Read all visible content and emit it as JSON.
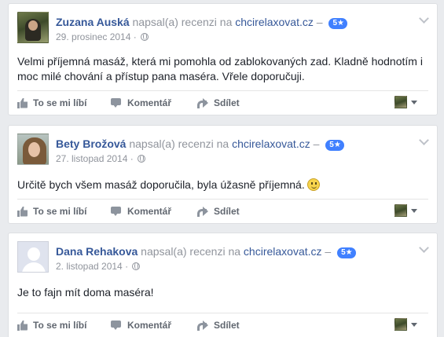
{
  "reviews": [
    {
      "author": "Zuzana Auská",
      "action_text": "napsal(a) recenzi na",
      "site": "chcirelaxovat.cz",
      "dash": "–",
      "rating_badge": "5★",
      "date": "29. prosinec 2014 ·",
      "text": "Velmi příjemná masáž, která mi pomohla od zablokovaných zad. Kladně hodnotím i moc milé chování a přístup pana maséra. Vřele doporučuji.",
      "avatar": "profile-photo"
    },
    {
      "author": "Bety Brožová",
      "action_text": "napsal(a) recenzi na",
      "site": "chcirelaxovat.cz",
      "dash": "–",
      "rating_badge": "5★",
      "date": "27. listopad 2014 ·",
      "text": "Určitě bych všem masáž doporučila, byla úžasně příjemná.",
      "emoji": "smile-emoji",
      "avatar": "profile-photo"
    },
    {
      "author": "Dana Rehakova",
      "action_text": "napsal(a) recenzi na",
      "site": "chcirelaxovat.cz",
      "dash": "–",
      "rating_badge": "5★",
      "date": "2. listopad 2014 ·",
      "text": "Je to fajn mít doma maséra!",
      "avatar": "default-silhouette"
    }
  ],
  "actions": {
    "like_label": "To se mi líbí",
    "comment_label": "Komentář",
    "share_label": "Sdílet"
  },
  "icons": {
    "like": "thumbs-up-icon",
    "comment": "comment-bubble-icon",
    "share": "share-arrow-icon",
    "privacy": "globe-icon",
    "options": "chevron-down-icon"
  },
  "colors": {
    "page_background": "#e9ebee",
    "link_blue": "#365899",
    "rating_badge": "#4080ff",
    "meta_gray": "#90949c",
    "action_gray": "#616770"
  }
}
